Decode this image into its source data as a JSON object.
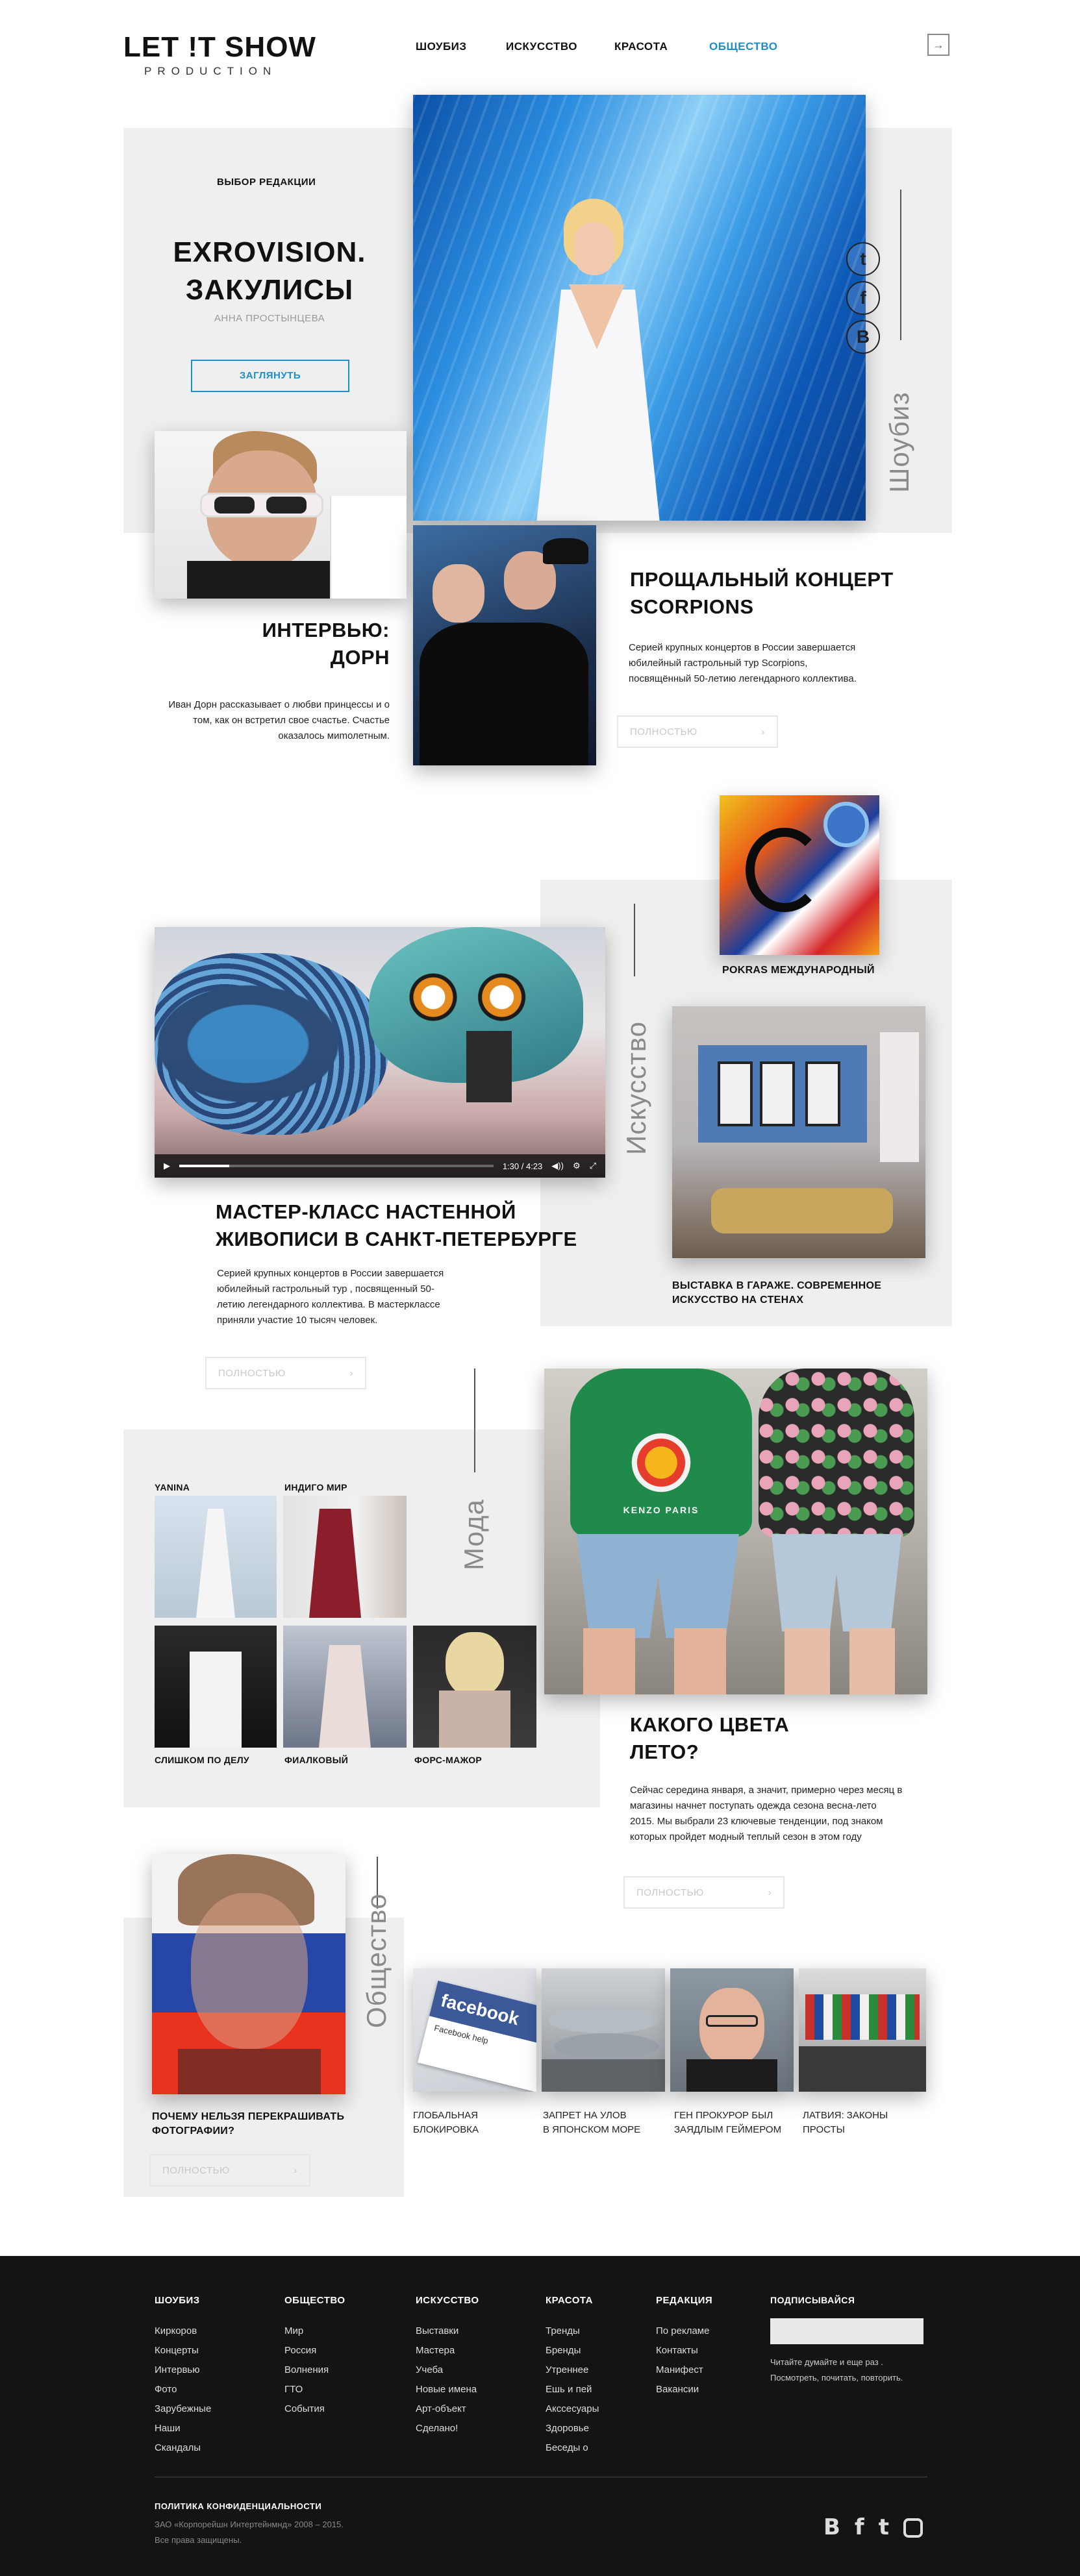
{
  "header": {
    "logo_top": "LET !T SHOW",
    "logo_bottom": "PRODUCTION",
    "nav": [
      "ШОУБИЗ",
      "ИСКУССТВО",
      "КРАСОТА",
      "ОБЩЕСТВО"
    ],
    "active_nav": "ОБЩЕСТВО",
    "accent": "#1b8fcb"
  },
  "hero": {
    "kicker": "ВЫБОР РЕДАКЦИИ",
    "title_1": "EXROVISION.",
    "title_2": "ЗАКУЛИСЫ",
    "author": "АННА ПРОСТЫНЦЕВА",
    "button": "ЗАГЛЯНУТЬ",
    "section_label": "Шоубиз",
    "social": [
      "twitter-icon",
      "facebook-icon",
      "vk-icon"
    ]
  },
  "interview": {
    "title_1": "ИНТЕРВЬЮ:",
    "title_2": "ДОРН",
    "text": "Иван Дорн рассказывает о любви принцессы и о том, как он встретил свое счастье. Счастье оказалось миmолетным."
  },
  "scorpions": {
    "title_1": "ПРОЩАЛЬНЫЙ КОНЦЕРТ",
    "title_2": "SCORPIONS",
    "text": "Серией крупных концертов в России завершается юбилейный гастрольный тур Scorpions, посвящённый 50-летию легендарного коллектива.",
    "button": "ПОЛНОСТЬЮ"
  },
  "art": {
    "section_label": "Искусство",
    "pokras": "POKRAS МЕЖДУНАРОДНЫЙ",
    "video_time": "1:30 / 4:23",
    "main_title_1": "МАСТЕР-КЛАСС НАСТЕННОЙ",
    "main_title_2": "ЖИВОПИСИ В САНКТ-ПЕТЕРБУРГЕ",
    "main_text": "Серией крупных концертов в России завершается юбилейный гастрольный тур , посвященный 50-летию легендарного коллектива. В мастерклассе приняли участие 10 тысяч человек.",
    "button": "ПОЛНОСТЬЮ",
    "garage_1": "ВЫСТАВКА В ГАРАЖЕ. СОВРЕМЕННОЕ",
    "garage_2": "ИСКУССТВО НА СТЕНАХ"
  },
  "fashion": {
    "section_label": "Мода",
    "items": [
      "YANINA",
      "ИНДИГО МИР",
      "СЛИШКОМ ПО ДЕЛУ",
      "ФИАЛКОВЫЙ",
      "ФОРС-МАЖОР"
    ],
    "title_1": "КАКОГО ЦВЕТА",
    "title_2": "ЛЕТО?",
    "text": "Сейчас середина января, а значит, примерно через месяц в магазины начнет поступать одежда сезона весна-лето 2015. Мы выбрали 23 ключевые тенденции, под знаком которых пройдет модный теплый сезон в этом году",
    "button": "ПОЛНОСТЬЮ",
    "sweater_text": "KENZO PARIS"
  },
  "society": {
    "section_label": "Общество",
    "main_1": "ПОЧЕМУ НЕЛЬЗЯ ПЕРЕКРАШИВАТЬ",
    "main_2": "ФОТОГРАФИИ?",
    "button": "ПОЛНОСТЬЮ",
    "fb_word": "facebook",
    "fb_sub": "Facebook help",
    "items": [
      [
        "ГЛОБАЛЬНАЯ",
        "БЛОКИРОВКА"
      ],
      [
        "ЗАПРЕТ НА УЛОВ",
        "В ЯПОНСКОМ МОРЕ"
      ],
      [
        "ГЕН ПРОКУРОР БЫЛ",
        "ЗАЯДЛЫМ  ГЕЙМЕРОМ"
      ],
      [
        "ЛАТВИЯ: ЗАКОНЫ",
        "ПРОСТЫ"
      ]
    ]
  },
  "footer": {
    "columns": [
      {
        "title": "ШОУБИЗ",
        "items": [
          "Киркоров",
          "Концерты",
          "Интервью",
          "Фото",
          "Зарубежные",
          "Наши",
          "Скандалы"
        ]
      },
      {
        "title": "ОБЩЕСТВО",
        "items": [
          "Мир",
          "Россия",
          "Волнения",
          "ГТО",
          "События"
        ]
      },
      {
        "title": "ИСКУССТВО",
        "items": [
          "Выставки",
          "Мастера",
          "Учеба",
          "Новые имена",
          "Арт-объект",
          "Сделано!"
        ]
      },
      {
        "title": "КРАСОТА",
        "items": [
          "Тренды",
          "Бренды",
          "Утреннее",
          "Ешь и пей",
          "Акссесуары",
          "Здоровье",
          "Беседы о"
        ]
      },
      {
        "title": "РЕДАКЦИЯ",
        "items": [
          "По рекламе",
          "Контакты",
          "Манифест",
          "Вакансии"
        ]
      }
    ],
    "subscribe_title": "ПОДПИСЫВАЙСЯ",
    "subscribe_placeholder": "",
    "subscribe_text_1": "Читайте думайте и еще раз .",
    "subscribe_text_2": "Посмотреть, почитать, повторить.",
    "privacy": "ПОЛИТИКА КОНФИДЕНЦИАЛЬНОСТИ",
    "copyright_1": "ЗАО «Корпорейшн Интертейнмнд» 2008 – 2015.",
    "copyright_2": "Все права защищены.",
    "social": [
      "vk-icon",
      "facebook-icon",
      "twitter-icon",
      "instagram-icon"
    ]
  }
}
